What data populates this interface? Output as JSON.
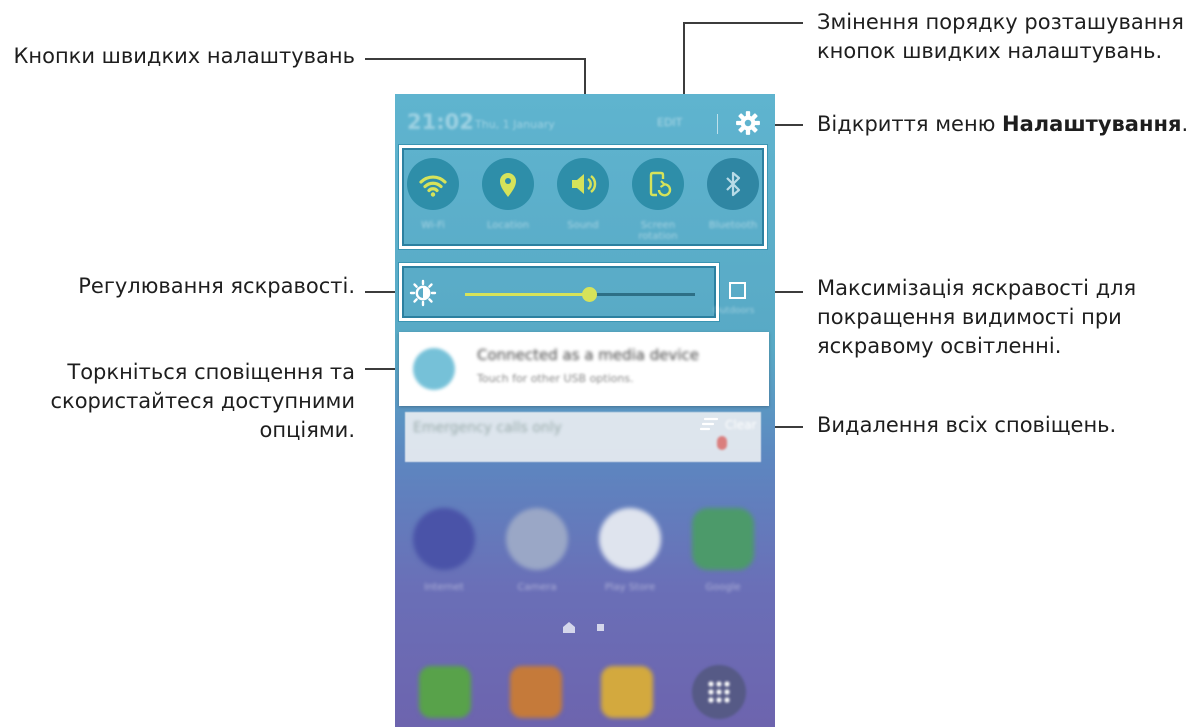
{
  "callouts": {
    "quick_settings_buttons": "Кнопки швидких налаштувань",
    "reorder_line1": "Змінення порядку розташування",
    "reorder_line2": "кнопок швидких налаштувань.",
    "settings_prefix": "Відкриття меню ",
    "settings_bold": "Налаштування",
    "settings_suffix": ".",
    "brightness_adjust": "Регулювання яскравості.",
    "max_brightness_line1": "Максимізація яскравості для",
    "max_brightness_line2": "покращення видимості при",
    "max_brightness_line3": "яскравому освітленні.",
    "notif_line1": "Торкніться сповіщення та",
    "notif_line2": "скористайтеся доступними",
    "notif_line3": "опціями.",
    "clear_all": "Видалення всіх сповіщень."
  },
  "phone": {
    "status": {
      "time": "21:02",
      "date": "Thu, 1 January",
      "edit_label": "EDIT"
    },
    "quick_settings": [
      {
        "label": "Wi-Fi",
        "icon": "wifi-icon",
        "on": true
      },
      {
        "label": "Location",
        "icon": "location-icon",
        "on": true
      },
      {
        "label": "Sound",
        "icon": "sound-icon",
        "on": true
      },
      {
        "label": "Screen rotation",
        "icon": "screen-rotation-icon",
        "on": true
      },
      {
        "label": "Bluetooth",
        "icon": "bluetooth-icon",
        "on": false
      }
    ],
    "brightness": {
      "level": 0.54,
      "auto_label": "Outdoors"
    },
    "notification": {
      "title": "Connected as a media device",
      "subtitle": "Touch for other USB options."
    },
    "search_text": "Emergency calls only",
    "clear_label": "Clear",
    "apps": [
      "Internet",
      "Camera",
      "Play Store",
      "Google"
    ],
    "colors": {
      "accent": "#d6e35a",
      "panel": "#5fb4cf",
      "toggle_bg": "#2e8ea9"
    }
  }
}
